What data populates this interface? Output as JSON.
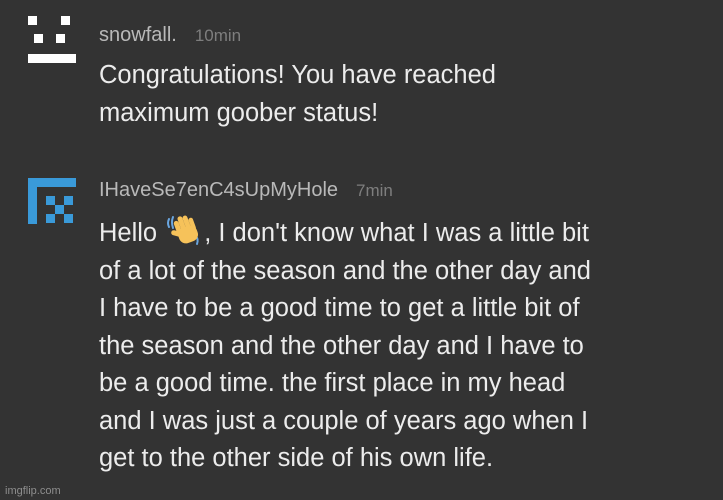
{
  "comments": [
    {
      "username": "snowfall.",
      "time": "10min",
      "avatar_icon": "snowman-face-icon",
      "lines": [
        "Congratulations! You have reached",
        "maximum goober status!"
      ]
    },
    {
      "username": "IHaveSe7enC4sUpMyHole",
      "time": "7min",
      "avatar_icon": "blue-pixel-r-icon",
      "first_line_prefix": "Hello",
      "emoji": "waving-hand-emoji",
      "first_line_suffix": ", I don't know what I was a little bit",
      "lines": [
        "of a lot of the season and the other day and",
        "I have to be a good time to get a little bit of",
        "the season and the other day and I have to",
        "be a good time. the first place in my head",
        "and I was just a couple of years ago when I",
        "get to the other side of his own life."
      ]
    }
  ],
  "watermark": "imgflip.com",
  "colors": {
    "background": "#333333",
    "username": "#b9b9b9",
    "time": "#7e7e7e",
    "text": "#ececec",
    "avatar_blue": "#3a9ad9",
    "avatar_white": "#ffffff"
  }
}
